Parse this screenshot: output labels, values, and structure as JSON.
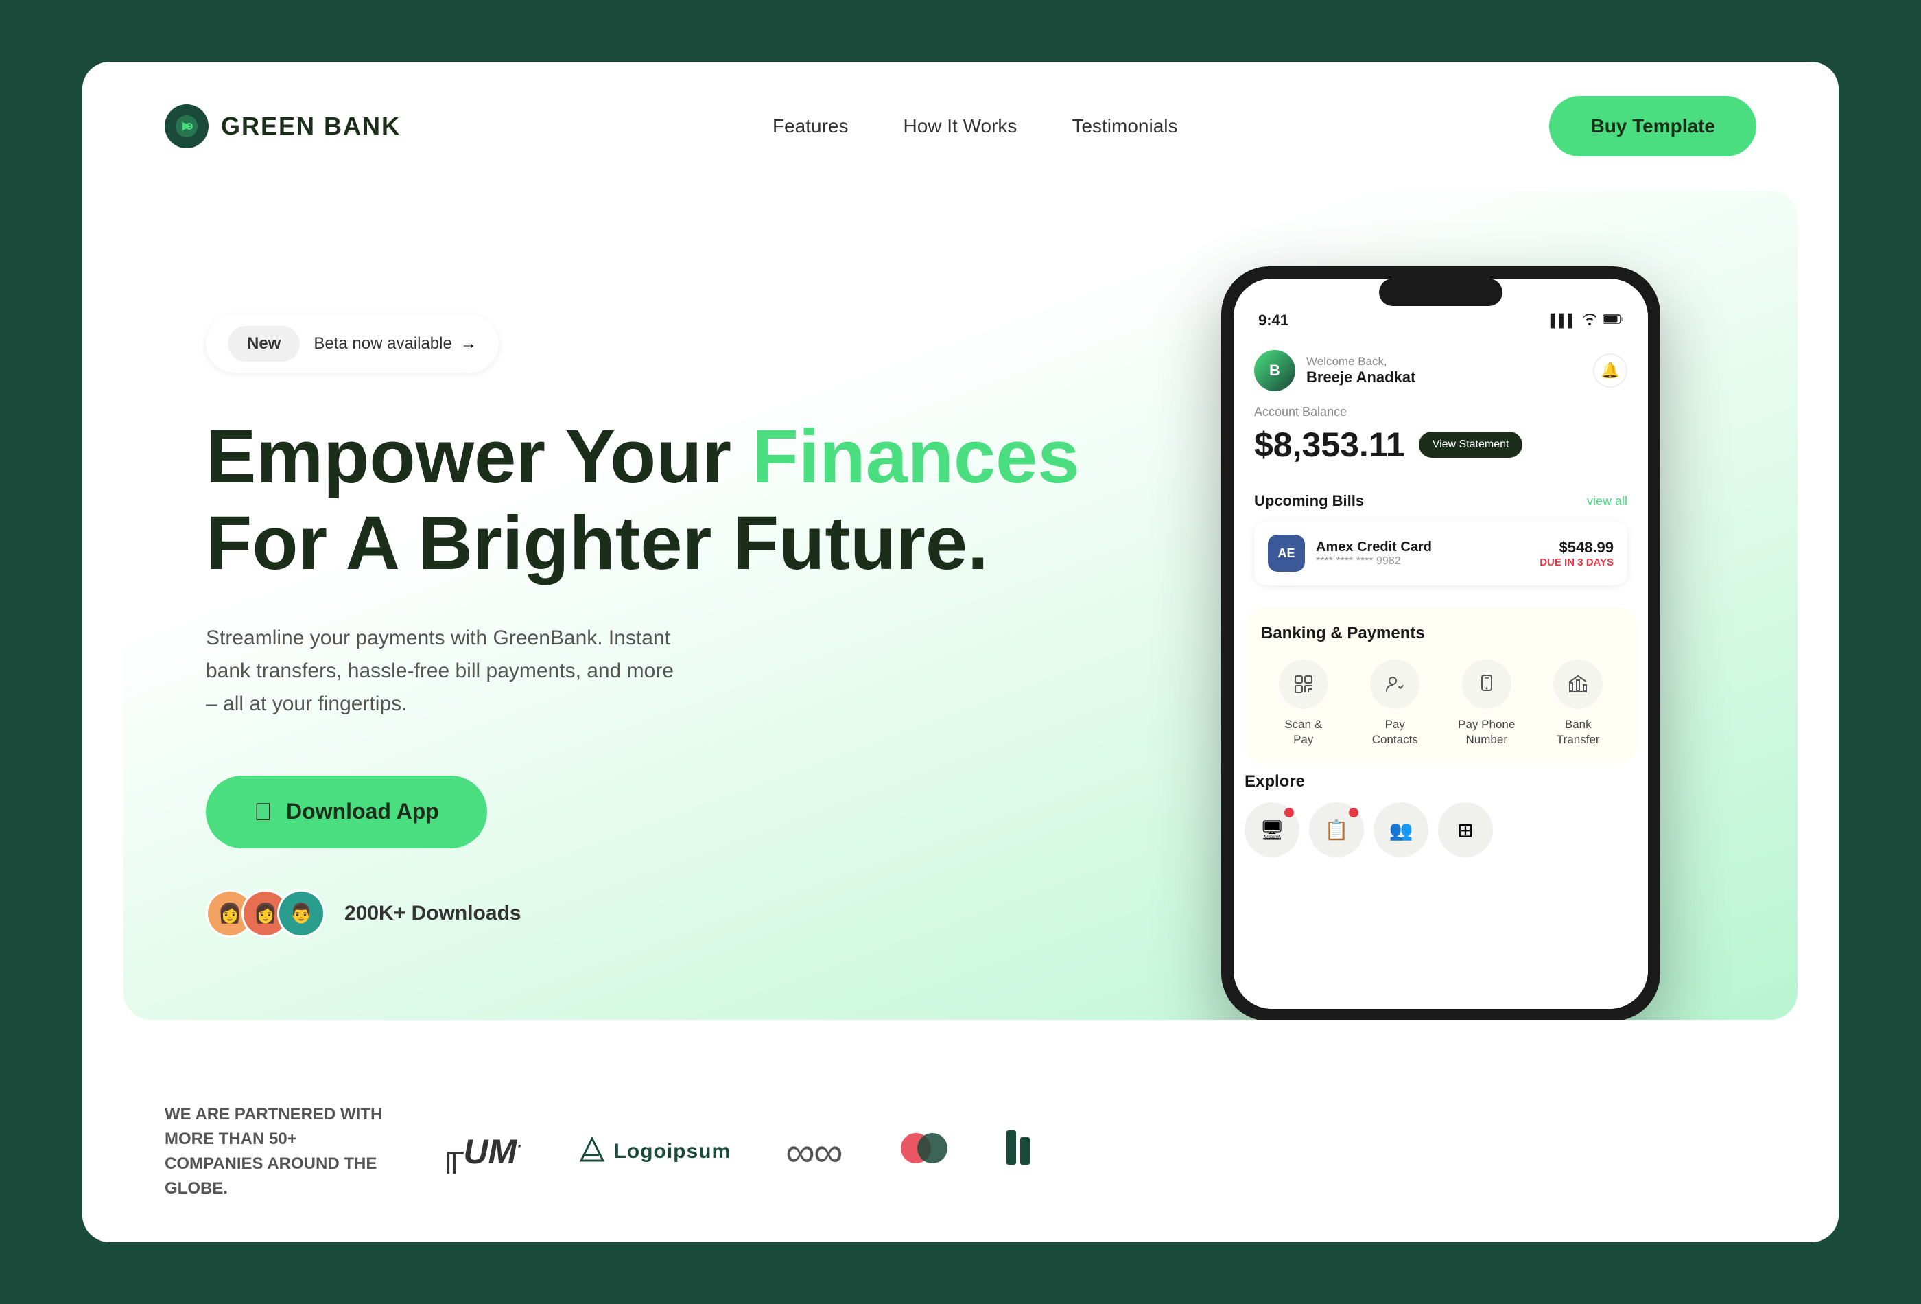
{
  "meta": {
    "background_color": "#1a4a3a"
  },
  "navbar": {
    "logo_text": "GREEN BANK",
    "nav_links": [
      {
        "id": "features",
        "label": "Features"
      },
      {
        "id": "how-it-works",
        "label": "How It Works"
      },
      {
        "id": "testimonials",
        "label": "Testimonials"
      }
    ],
    "buy_btn_label": "Buy Template"
  },
  "hero": {
    "badge_new": "New",
    "badge_text": "Beta now available",
    "badge_arrow": "→",
    "title_line1_plain": "Empower Your ",
    "title_line1_highlight": "Finances",
    "title_line2": "For A Brighter Future.",
    "subtitle": "Streamline your payments with GreenBank. Instant bank transfers, hassle-free bill payments, and more – all at your fingertips.",
    "download_btn_label": "Download App",
    "downloads_text": "200K+ Downloads"
  },
  "phone": {
    "status_bar": {
      "time": "9:41",
      "signal": "▌▌▌",
      "wifi": "wifi",
      "battery": "battery"
    },
    "header": {
      "welcome": "Welcome Back,",
      "username": "Breeje Anadkat"
    },
    "balance": {
      "label": "Account Balance",
      "amount": "$8,353.11",
      "view_statement": "View Statement"
    },
    "upcoming_bills": {
      "title": "Upcoming Bills",
      "view_all": "view all",
      "bill": {
        "name": "Amex Credit Card",
        "number": "**** **** **** 9982",
        "amount": "$548.99",
        "due": "DUE IN 3 DAYS"
      }
    },
    "banking": {
      "title": "Banking & Payments",
      "items": [
        {
          "id": "scan-pay",
          "icon": "⇄",
          "label": "Scan &\nPay"
        },
        {
          "id": "pay-contacts",
          "icon": "👤",
          "label": "Pay\nContacts"
        },
        {
          "id": "pay-phone",
          "icon": "📱",
          "label": "Pay Phone\nNumber"
        },
        {
          "id": "bank-transfer",
          "icon": "🏦",
          "label": "Bank\nTransfer"
        }
      ]
    },
    "explore": {
      "title": "Explore",
      "items": [
        {
          "id": "item1",
          "icon": "🖥",
          "dot": true
        },
        {
          "id": "item2",
          "icon": "📋",
          "dot": true
        },
        {
          "id": "item3",
          "icon": "👥",
          "dot": false
        },
        {
          "id": "item4",
          "icon": "⊞",
          "dot": false
        }
      ]
    }
  },
  "partners": {
    "text": "WE ARE PARTNERED WITH MORE THAN 50+ COMPANIES AROUND THE GLOBE.",
    "logos": [
      {
        "id": "um",
        "label": "ꓤUM"
      },
      {
        "id": "logoipsum",
        "label": "Logoipsum"
      },
      {
        "id": "loops",
        "label": "∞"
      },
      {
        "id": "mastercard",
        "label": "⬤⬤"
      },
      {
        "id": "bars",
        "label": "I.I"
      }
    ]
  }
}
